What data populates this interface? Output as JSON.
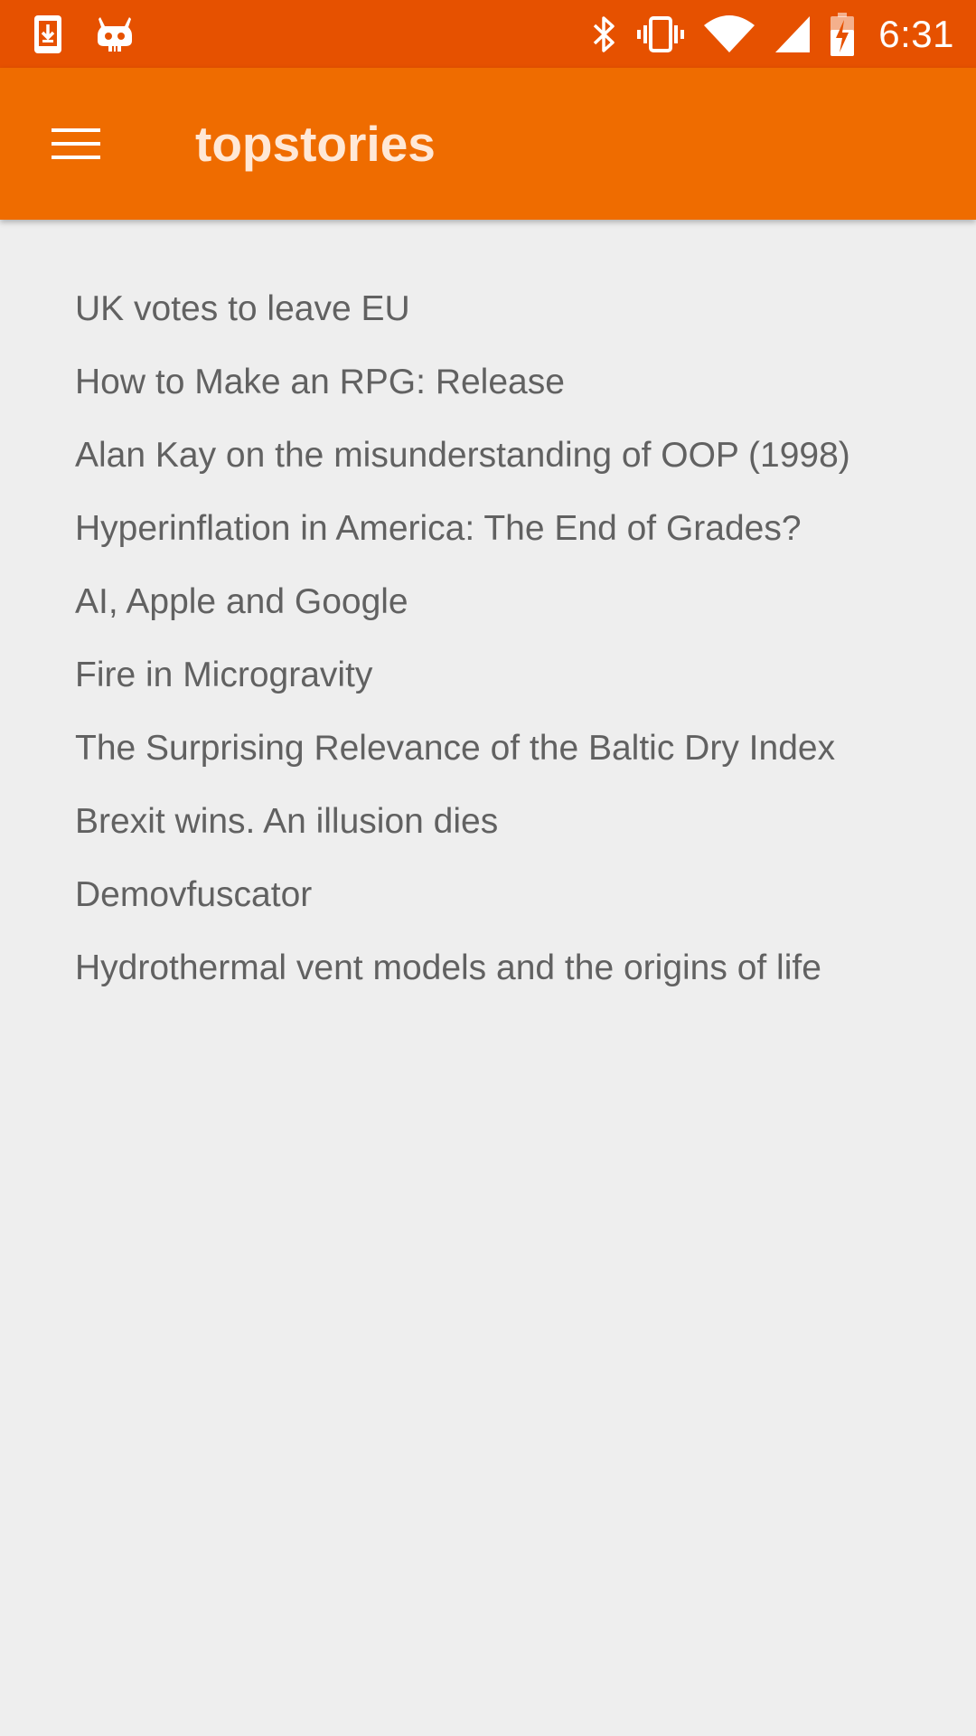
{
  "status_bar": {
    "left_icons": [
      "download-notification-icon",
      "cyanogen-mod-icon"
    ],
    "right_icons": [
      "bluetooth-icon",
      "vibrate-icon",
      "wifi-icon",
      "cell-signal-icon",
      "battery-charging-icon"
    ],
    "time": "6:31",
    "background_color": "#e65100"
  },
  "app_bar": {
    "menu_icon": "hamburger-menu-icon",
    "title": "topstories",
    "background_color": "#ef6c00"
  },
  "stories": [
    {
      "title": "UK votes to leave EU"
    },
    {
      "title": "How to Make an RPG: Release"
    },
    {
      "title": "Alan Kay on the misunderstanding of OOP (1998)"
    },
    {
      "title": "Hyperinflation in America: The End of Grades?"
    },
    {
      "title": "AI, Apple and Google"
    },
    {
      "title": "Fire in Microgravity"
    },
    {
      "title": "The Surprising Relevance of the Baltic Dry Index"
    },
    {
      "title": "Brexit wins. An illusion dies"
    },
    {
      "title": "Demovfuscator"
    },
    {
      "title": "Hydrothermal vent models and the origins of life"
    }
  ]
}
